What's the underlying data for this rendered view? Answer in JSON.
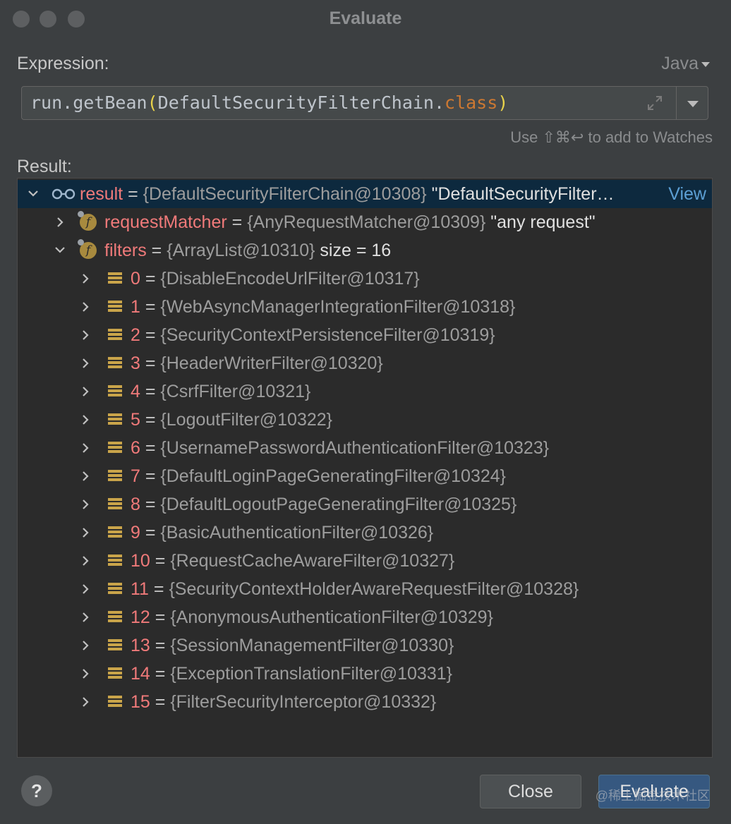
{
  "window": {
    "title": "Evaluate"
  },
  "expression": {
    "label": "Expression:",
    "language": "Java",
    "code_prefix": "run.getBean",
    "open_paren": "(",
    "code_class": "DefaultSecurityFilterChain.",
    "code_keyword": "class",
    "close_paren": ")",
    "hint": "Use ⇧⌘↩ to add to Watches"
  },
  "result": {
    "label": "Result:",
    "root": {
      "name": "result",
      "eq": " = ",
      "ref": "{DefaultSecurityFilterChain@10308}",
      "str": " \"DefaultSecurityFilter…",
      "view": "View"
    },
    "fields": [
      {
        "name": "requestMatcher",
        "eq": " = ",
        "ref": "{AnyRequestMatcher@10309}",
        "extra": " \"any request\""
      },
      {
        "name": "filters",
        "eq": " = ",
        "ref": "{ArrayList@10310}",
        "extra": "  size = 16"
      }
    ],
    "items": [
      {
        "index": "0",
        "ref": "{DisableEncodeUrlFilter@10317}"
      },
      {
        "index": "1",
        "ref": "{WebAsyncManagerIntegrationFilter@10318}"
      },
      {
        "index": "2",
        "ref": "{SecurityContextPersistenceFilter@10319}"
      },
      {
        "index": "3",
        "ref": "{HeaderWriterFilter@10320}"
      },
      {
        "index": "4",
        "ref": "{CsrfFilter@10321}"
      },
      {
        "index": "5",
        "ref": "{LogoutFilter@10322}"
      },
      {
        "index": "6",
        "ref": "{UsernamePasswordAuthenticationFilter@10323}"
      },
      {
        "index": "7",
        "ref": "{DefaultLoginPageGeneratingFilter@10324}"
      },
      {
        "index": "8",
        "ref": "{DefaultLogoutPageGeneratingFilter@10325}"
      },
      {
        "index": "9",
        "ref": "{BasicAuthenticationFilter@10326}"
      },
      {
        "index": "10",
        "ref": "{RequestCacheAwareFilter@10327}"
      },
      {
        "index": "11",
        "ref": "{SecurityContextHolderAwareRequestFilter@10328}"
      },
      {
        "index": "12",
        "ref": "{AnonymousAuthenticationFilter@10329}"
      },
      {
        "index": "13",
        "ref": "{SessionManagementFilter@10330}"
      },
      {
        "index": "14",
        "ref": "{ExceptionTranslationFilter@10331}"
      },
      {
        "index": "15",
        "ref": "{FilterSecurityInterceptor@10332}"
      }
    ]
  },
  "buttons": {
    "help": "?",
    "close": "Close",
    "evaluate": "Evaluate"
  },
  "watermark": "@稀土掘金技术社区"
}
